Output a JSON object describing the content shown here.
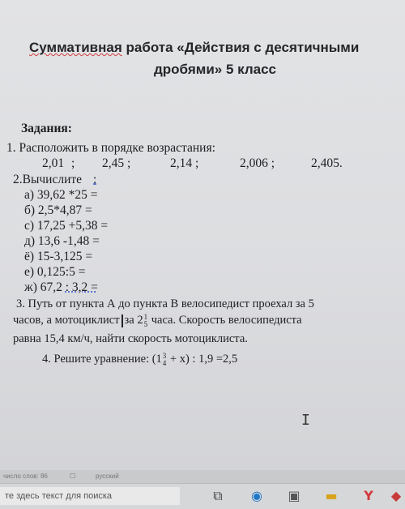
{
  "document": {
    "title_part1": "Суммативная",
    "title_part2": " работа  «Действия с десятичными",
    "title_line2": "дробями» 5 класс",
    "tasks_heading": "Задания:",
    "task1": {
      "text": "1. Расположить в порядке возрастания:",
      "numbers": [
        "2,01",
        ";",
        "2,45  ;",
        "2,14  ;",
        "2,006 ;",
        "2,405."
      ]
    },
    "task2": {
      "heading": "2.Вычислите",
      "heading_suffix": ":",
      "items": [
        "а)  39,62 *25 =",
        "б)  2,5*4,87  =",
        "с)  17,25 +5,38 =",
        "д)  13,6 -1,48 =",
        "ё)  15-3,125 =",
        "е)  0,125:5  =",
        "ж)  67,2 ",
        ": 3,2 ="
      ]
    },
    "task3": {
      "line1": "3. Путь от пункта А до пункта В велосипедист проехал за 5",
      "line2_a": "часов, а мотоциклист",
      "line2_b": "за 2",
      "frac_num": "1",
      "frac_den": "5",
      "line2_c": " часа. Скорость велосипедиста",
      "line3": "равна 15,4 км/ч, найти скорость мотоциклиста."
    },
    "task4": {
      "text_a": "4. Решите уравнение:  (1",
      "frac_num": "3",
      "frac_den": "4",
      "text_b": " + x) : 1,9 =2,5"
    },
    "cursor_glyph": "I"
  },
  "statusbar": {
    "words": "число слов: 86",
    "lang": "русский"
  },
  "taskbar": {
    "search_placeholder": "те здесь текст для поиска"
  },
  "colors": {
    "spellcheck": "#d23a3a",
    "grammar": "#3a57c9"
  }
}
